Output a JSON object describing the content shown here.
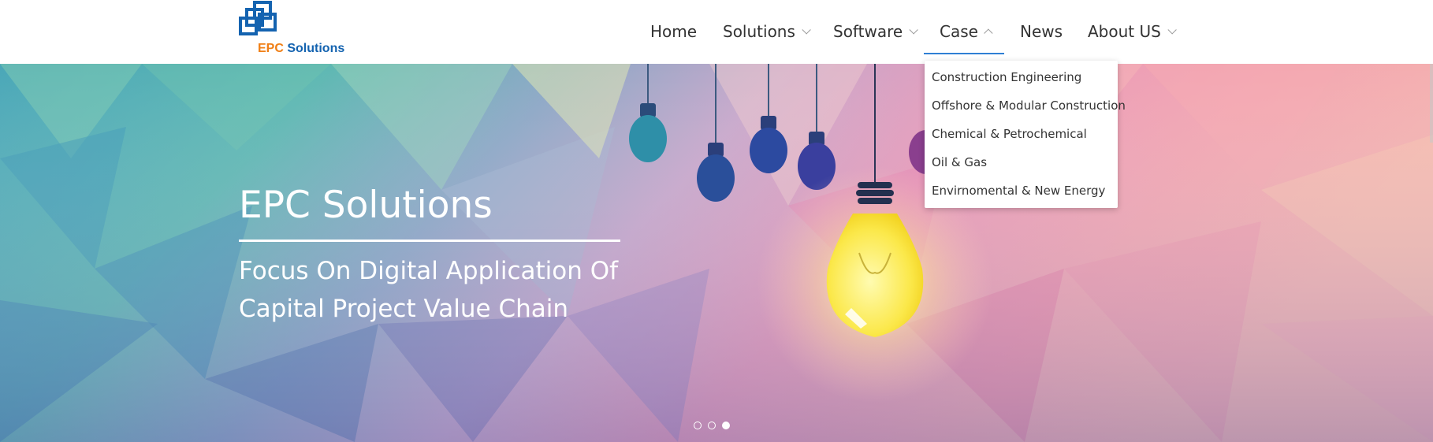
{
  "brand": {
    "name_part1": "EPC",
    "name_part2": "Solutions",
    "orange": "#f07f16",
    "blue": "#1463b0"
  },
  "nav": {
    "items": [
      {
        "label": "Home",
        "has_caret": false
      },
      {
        "label": "Solutions",
        "has_caret": true
      },
      {
        "label": "Software",
        "has_caret": true
      },
      {
        "label": "Case",
        "has_caret": true,
        "open": true
      },
      {
        "label": "News",
        "has_caret": false
      },
      {
        "label": "About US",
        "has_caret": true
      }
    ],
    "active_color": "#2f7fd4"
  },
  "case_dropdown": {
    "items": [
      "Construction Engineering",
      "Offshore & Modular Construction",
      "Chemical & Petrochemical",
      "Oil & Gas",
      "Envirnomental & New Energy"
    ]
  },
  "hero": {
    "title": "EPC Solutions",
    "subtitle": "Focus On Digital Application Of Capital Project Value Chain",
    "slides_total": 3,
    "active_slide": 3
  },
  "icons": {
    "caret": "chevron-down-icon",
    "caret_open": "chevron-up-icon",
    "logo": "overlapping-squares-logo"
  }
}
